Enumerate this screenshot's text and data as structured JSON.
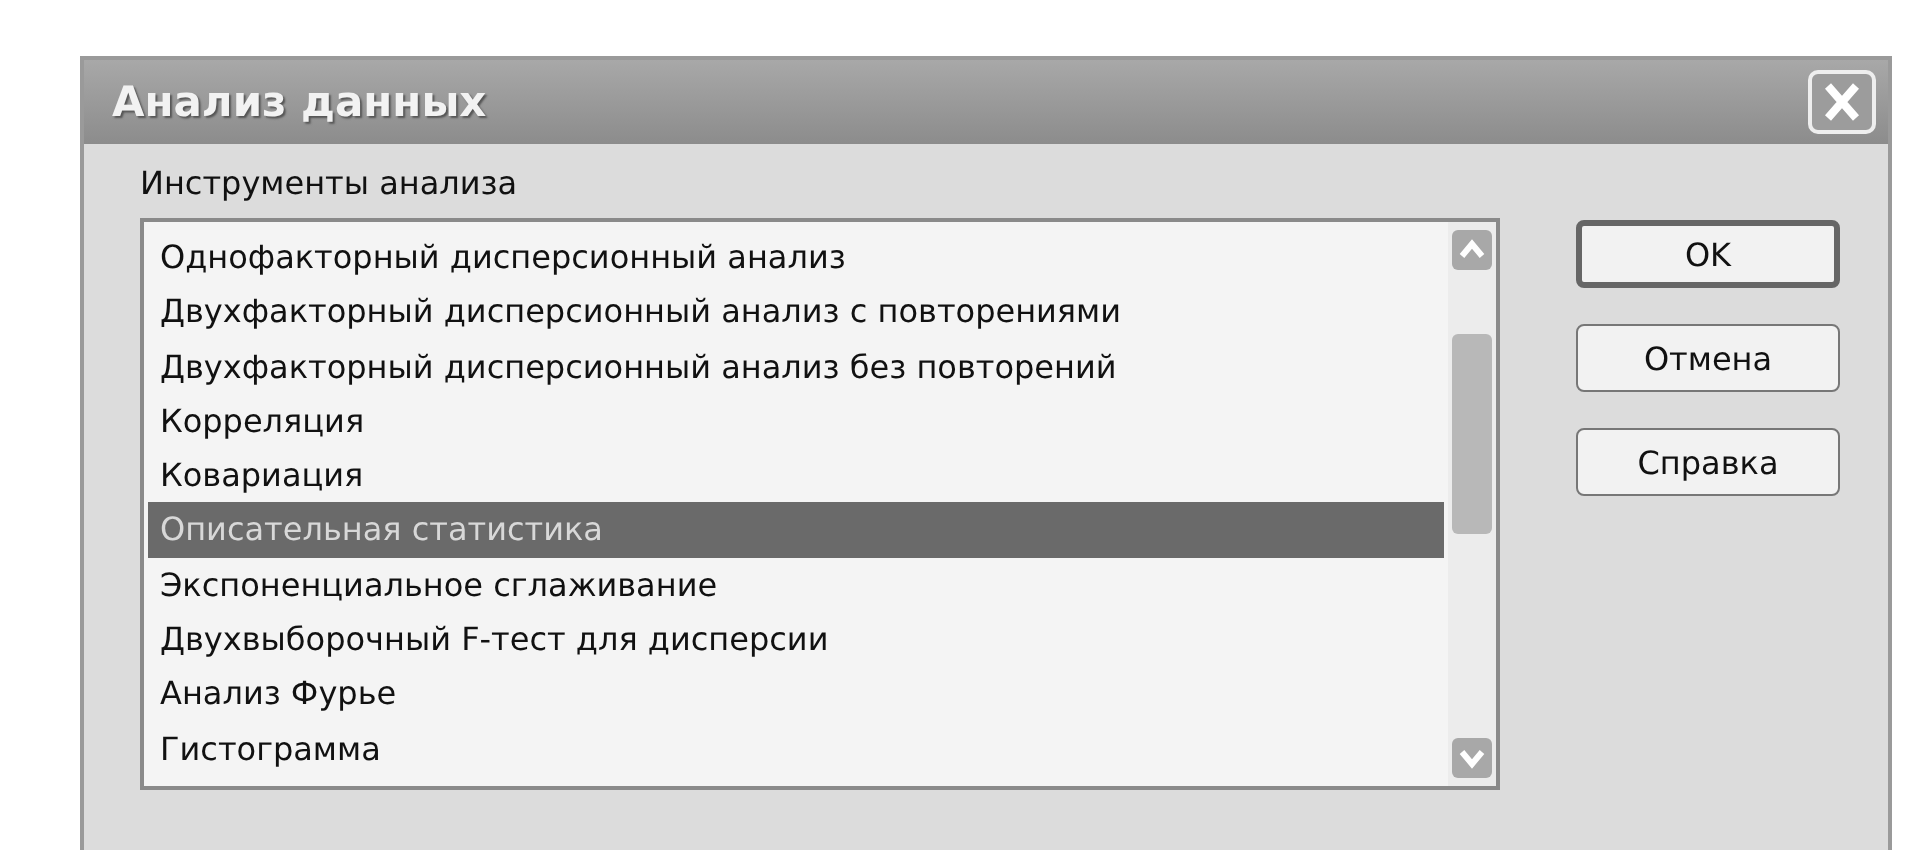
{
  "window": {
    "title": "Анализ данных"
  },
  "tools_label": "Инструменты анализа",
  "tools": [
    {
      "label": "Однофакторный дисперсионный анализ",
      "selected": false
    },
    {
      "label": "Двухфакторный дисперсионный анализ с повторениями",
      "selected": false
    },
    {
      "label": "Двухфакторный дисперсионный анализ без повторений",
      "selected": false
    },
    {
      "label": "Корреляция",
      "selected": false
    },
    {
      "label": "Ковариация",
      "selected": false
    },
    {
      "label": "Описательная статистика",
      "selected": true
    },
    {
      "label": "Экспоненциальное сглаживание",
      "selected": false
    },
    {
      "label": "Двухвыборочный F-тест для дисперсии",
      "selected": false
    },
    {
      "label": "Анализ Фурье",
      "selected": false
    },
    {
      "label": "Гистограмма",
      "selected": false
    }
  ],
  "buttons": [
    {
      "label": "OK",
      "kind": "default"
    },
    {
      "label": "Отмена",
      "kind": "normal"
    },
    {
      "label": "Справка",
      "kind": "normal"
    }
  ]
}
